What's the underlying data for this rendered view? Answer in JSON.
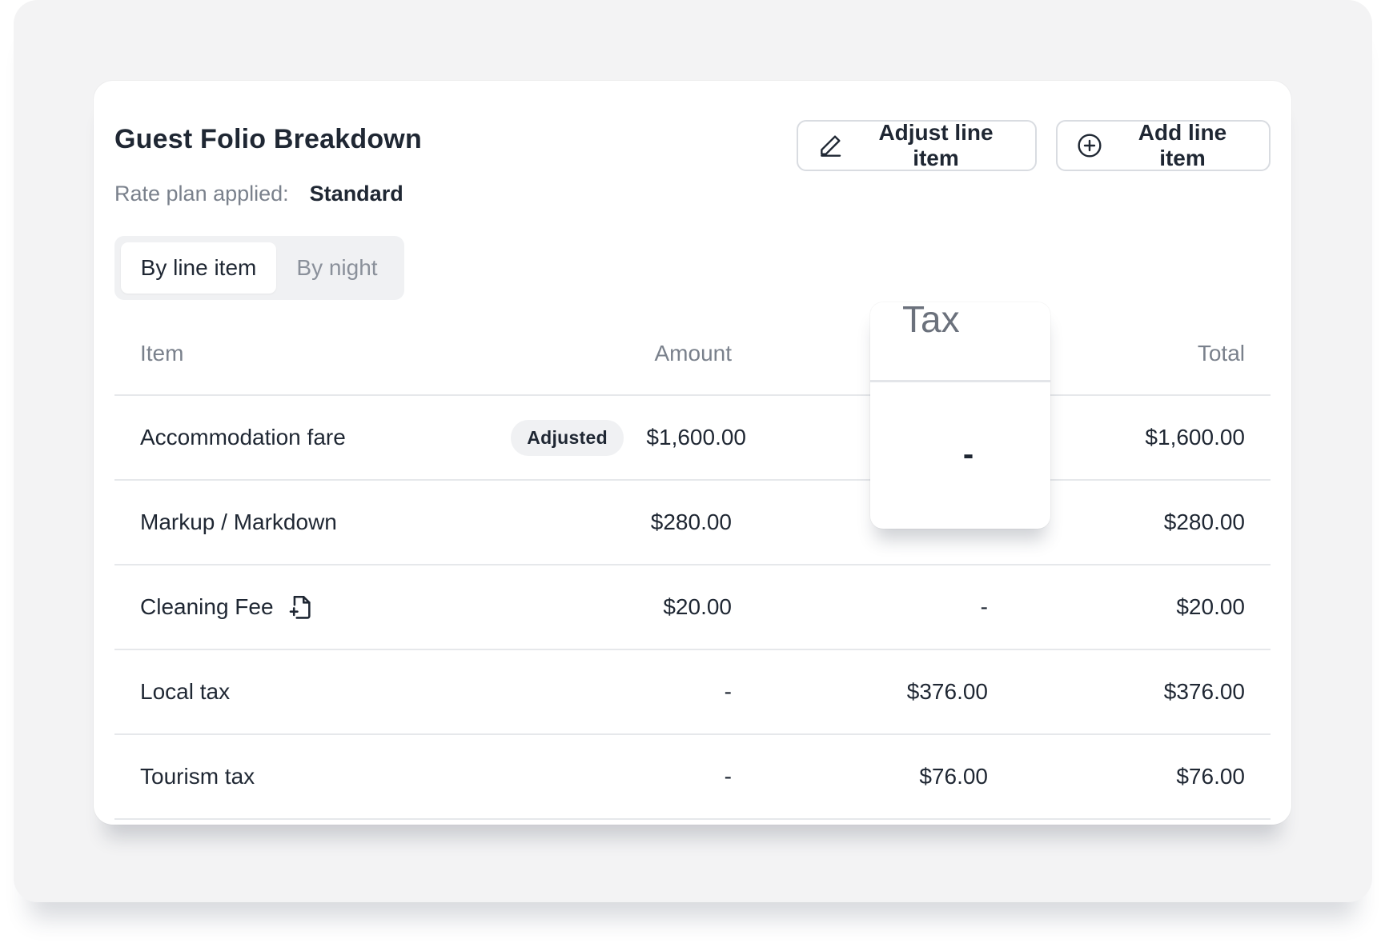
{
  "header": {
    "title": "Guest Folio Breakdown",
    "rate_plan_label": "Rate plan applied:",
    "rate_plan_value": "Standard",
    "adjust_button_label": "Adjust line item",
    "add_button_label": "Add line item"
  },
  "view_toggle": {
    "options": [
      "By line item",
      "By night"
    ],
    "selected": "By line item"
  },
  "table": {
    "columns": {
      "item": "Item",
      "amount": "Amount",
      "tax": "Tax",
      "total": "Total"
    },
    "rows": [
      {
        "item": "Accommodation fare",
        "badge": "Adjusted",
        "amount": "$1,600.00",
        "tax": "-",
        "total": "$1,600.00"
      },
      {
        "item": "Markup / Markdown",
        "amount": "$280.00",
        "tax": "-",
        "total": "$280.00"
      },
      {
        "item": "Cleaning Fee",
        "icon": "file-plus-icon",
        "amount": "$20.00",
        "tax": "-",
        "total": "$20.00"
      },
      {
        "item": "Local tax",
        "amount": "-",
        "tax": "$376.00",
        "total": "$376.00"
      },
      {
        "item": "Tourism tax",
        "amount": "-",
        "tax": "$76.00",
        "total": "$76.00"
      }
    ]
  },
  "tax_popout": {
    "heading": "Tax",
    "value": "-"
  },
  "icons": {
    "adjust": "pencil-icon",
    "add": "plus-circle-icon"
  },
  "colors": {
    "text": "#1f2733",
    "muted": "#7a818c",
    "border": "#e6e8eb",
    "badge_bg": "#f0f1f3"
  }
}
